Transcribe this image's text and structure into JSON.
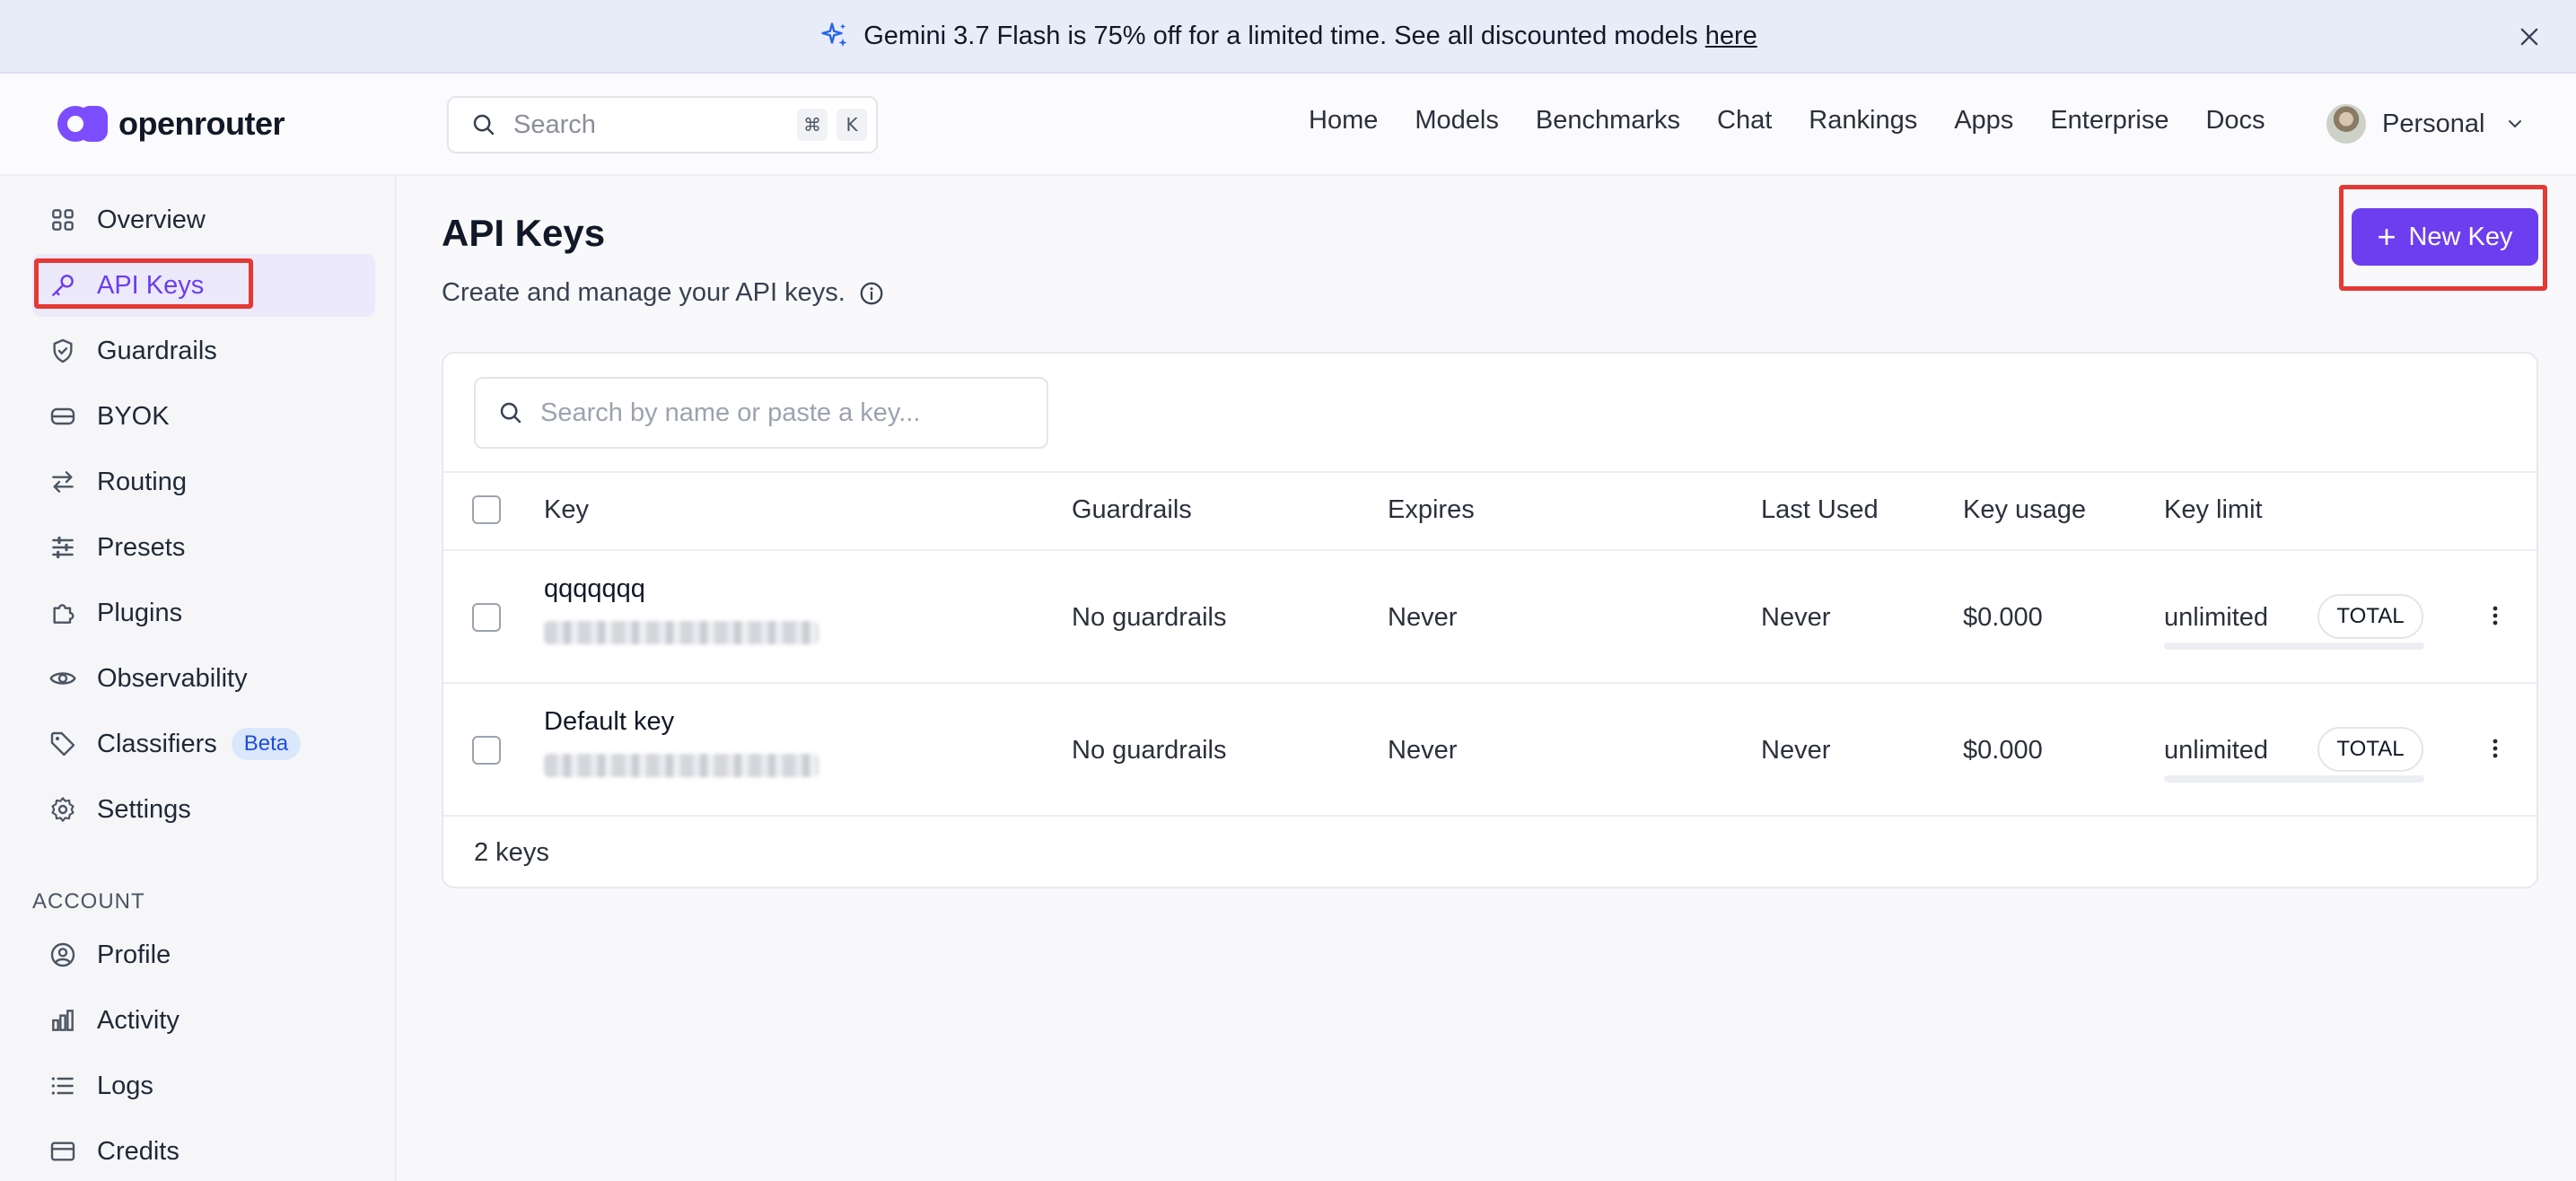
{
  "banner": {
    "text": "Gemini 3.7 Flash is 75% off for a limited time. See all discounted models",
    "link": "here",
    "close_icon": "close-icon",
    "spark_icon": "sparkle-icon"
  },
  "header": {
    "logo_text": "openrouter",
    "search_placeholder": "Search",
    "search_kbd_1": "⌘",
    "search_kbd_2": "K",
    "nav": [
      "Home",
      "Models",
      "Benchmarks",
      "Chat",
      "Rankings",
      "Apps",
      "Enterprise",
      "Docs"
    ],
    "profile_label": "Personal"
  },
  "sidebar": {
    "items": [
      {
        "label": "Overview",
        "icon": "grid-icon"
      },
      {
        "label": "API Keys",
        "icon": "key-icon",
        "active": true
      },
      {
        "label": "Guardrails",
        "icon": "shield-icon"
      },
      {
        "label": "BYOK",
        "icon": "database-icon"
      },
      {
        "label": "Routing",
        "icon": "arrows-swap-icon"
      },
      {
        "label": "Presets",
        "icon": "sliders-icon"
      },
      {
        "label": "Plugins",
        "icon": "puzzle-icon"
      },
      {
        "label": "Observability",
        "icon": "eye-icon"
      },
      {
        "label": "Classifiers",
        "icon": "tag-icon",
        "badge": "Beta"
      },
      {
        "label": "Settings",
        "icon": "gear-icon"
      }
    ],
    "account_section": "ACCOUNT",
    "account_items": [
      {
        "label": "Profile",
        "icon": "user-circle-icon"
      },
      {
        "label": "Activity",
        "icon": "bar-chart-icon"
      },
      {
        "label": "Logs",
        "icon": "list-icon"
      },
      {
        "label": "Credits",
        "icon": "credit-card-icon"
      }
    ]
  },
  "main": {
    "title": "API Keys",
    "subtitle": "Create and manage your API keys.",
    "new_key_label": "New Key",
    "key_search_placeholder": "Search by name or paste a key...",
    "columns": [
      "Key",
      "Guardrails",
      "Expires",
      "Last Used",
      "Key usage",
      "Key limit"
    ],
    "rows": [
      {
        "name": "qqqqqqq",
        "guardrails": "No guardrails",
        "expires": "Never",
        "last_used": "Never",
        "usage": "$0.000",
        "limit": "unlimited",
        "limit_badge": "TOTAL"
      },
      {
        "name": "Default key",
        "guardrails": "No guardrails",
        "expires": "Never",
        "last_used": "Never",
        "usage": "$0.000",
        "limit": "unlimited",
        "limit_badge": "TOTAL"
      }
    ],
    "count_label": "2 keys"
  },
  "colors": {
    "accent": "#6d3df0",
    "highlight_box": "#e53935",
    "banner_bg": "#e8ecf9"
  }
}
